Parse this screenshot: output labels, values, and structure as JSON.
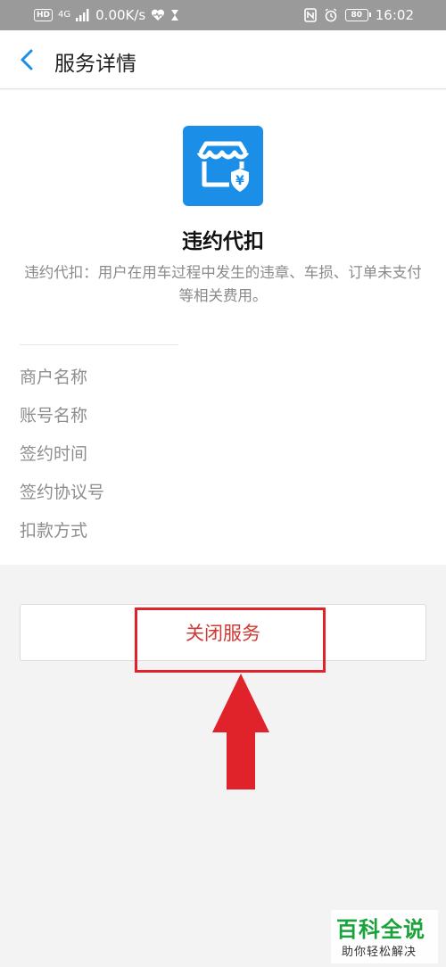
{
  "status_bar": {
    "network_badge": "HD",
    "network_type": "4G",
    "speed": "0.00K/s",
    "battery": "80",
    "time": "16:02",
    "icons": [
      "signal-icon",
      "heart-icon",
      "hourglass-icon",
      "nfc-icon",
      "alarm-icon",
      "battery-icon"
    ]
  },
  "nav": {
    "title": "服务详情",
    "back_icon": "chevron-left-icon"
  },
  "service": {
    "icon": "store-payment-icon",
    "name": "违约代扣",
    "description": "违约代扣：用户在用车过程中发生的违章、车损、订单未支付等相关费用。"
  },
  "info": {
    "labels": [
      "商户名称",
      "账号名称",
      "签约时间",
      "签约协议号",
      "扣款方式"
    ]
  },
  "actions": {
    "close_service": "关闭服务"
  },
  "watermark": {
    "title": "百科全说",
    "subtitle": "助你轻松解决"
  },
  "colors": {
    "accent_blue": "#1b8fe8",
    "close_red": "#d03a35",
    "highlight_red": "#e0222a",
    "watermark_green": "#1aa33a"
  }
}
